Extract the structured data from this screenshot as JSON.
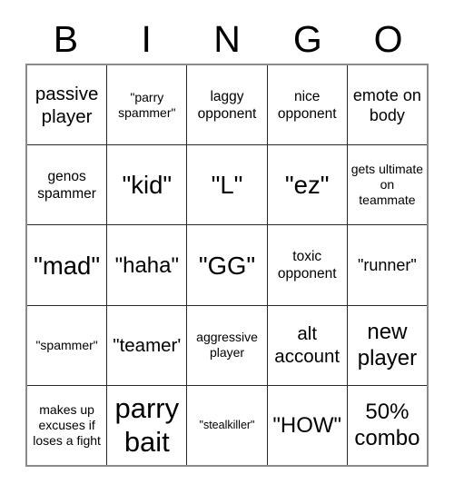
{
  "card": {
    "title": "BINGO",
    "header_letters": [
      "B",
      "I",
      "N",
      "G",
      "O"
    ],
    "grid_size": "5x5",
    "colors": {
      "background": "#ffffff",
      "text": "#000000",
      "inner_border": "#2b2b2b",
      "outer_border": "#8a8a8a"
    },
    "rows": [
      [
        {
          "text": "passive player",
          "size": "l"
        },
        {
          "text": "\"parry spammer\"",
          "size": "xs"
        },
        {
          "text": "laggy opponent",
          "size": "s"
        },
        {
          "text": "nice opponent",
          "size": "s"
        },
        {
          "text": "emote on body",
          "size": "m"
        }
      ],
      [
        {
          "text": "genos spammer",
          "size": "s"
        },
        {
          "text": "\"kid\"",
          "size": "xxl"
        },
        {
          "text": "\"L\"",
          "size": "xxl"
        },
        {
          "text": "\"ez\"",
          "size": "xxl"
        },
        {
          "text": "gets ultimate on teammate",
          "size": "xs"
        }
      ],
      [
        {
          "text": "\"mad\"",
          "size": "xxl"
        },
        {
          "text": "\"haha\"",
          "size": "xl"
        },
        {
          "text": "\"GG\"",
          "size": "xxl"
        },
        {
          "text": "toxic opponent",
          "size": "s"
        },
        {
          "text": "\"runner\"",
          "size": "m"
        }
      ],
      [
        {
          "text": "\"spammer\"",
          "size": "xs"
        },
        {
          "text": "\"teamer'",
          "size": "l"
        },
        {
          "text": "aggressive player",
          "size": "xs"
        },
        {
          "text": "alt account",
          "size": "l"
        },
        {
          "text": "new player",
          "size": "xl"
        }
      ],
      [
        {
          "text": "makes up excuses if loses a fight",
          "size": "xs"
        },
        {
          "text": "parry bait",
          "size": "huge"
        },
        {
          "text": "\"stealkiller\"",
          "size": "xxs"
        },
        {
          "text": "\"HOW\"",
          "size": "xl"
        },
        {
          "text": "50% combo",
          "size": "xl"
        }
      ]
    ]
  }
}
